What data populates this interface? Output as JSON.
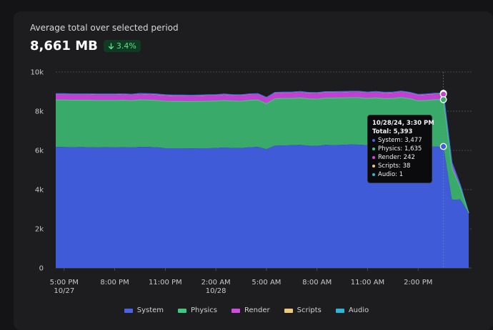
{
  "header": {
    "subtitle": "Average total over selected period",
    "total": "8,661 MB",
    "delta": "3.4%"
  },
  "tooltip": {
    "title": "10/28/24, 3:30 PM",
    "total": "Total: 5,393",
    "rows": [
      {
        "label": "System: 3,477",
        "color": "#4a63e6"
      },
      {
        "label": "Physics: 1,635",
        "color": "#3ccb7a"
      },
      {
        "label": "Render: 242",
        "color": "#d24be0"
      },
      {
        "label": "Scripts: 38",
        "color": "#efc87a"
      },
      {
        "label": "Audio: 1",
        "color": "#2ab8d8"
      }
    ]
  },
  "chart_data": {
    "type": "area",
    "stacked": true,
    "ylim": [
      0,
      10000
    ],
    "grid": true,
    "legend_position": "bottom",
    "y_ticks": [
      {
        "value": 0,
        "label": "0"
      },
      {
        "value": 2000,
        "label": "2k"
      },
      {
        "value": 4000,
        "label": "4k"
      },
      {
        "value": 6000,
        "label": "6k"
      },
      {
        "value": 8000,
        "label": "8k"
      },
      {
        "value": 10000,
        "label": "10k"
      }
    ],
    "x_ticks": [
      {
        "hour": 0,
        "label": "5:00 PM",
        "sublabel": "10/27"
      },
      {
        "hour": 3,
        "label": "8:00 PM",
        "sublabel": ""
      },
      {
        "hour": 6,
        "label": "11:00 PM",
        "sublabel": ""
      },
      {
        "hour": 9,
        "label": "2:00 AM",
        "sublabel": "10/28"
      },
      {
        "hour": 12,
        "label": "5:00 AM",
        "sublabel": ""
      },
      {
        "hour": 15,
        "label": "8:00 AM",
        "sublabel": ""
      },
      {
        "hour": 18,
        "label": "11:00 AM",
        "sublabel": ""
      },
      {
        "hour": 21,
        "label": "2:00 PM",
        "sublabel": ""
      }
    ],
    "x_hours_since_5pm_10_27": [
      -0.5,
      0,
      0.5,
      1,
      1.5,
      2,
      2.5,
      3,
      3.5,
      4,
      4.5,
      5,
      5.5,
      6,
      6.5,
      7,
      7.5,
      8,
      8.5,
      9,
      9.5,
      10,
      10.5,
      11,
      11.5,
      12,
      12.5,
      13,
      13.5,
      14,
      14.5,
      15,
      15.5,
      16,
      16.5,
      17,
      17.5,
      18,
      18.5,
      19,
      19.5,
      20,
      20.5,
      21,
      21.5,
      22,
      22.5,
      23,
      23.5,
      24
    ],
    "series": [
      {
        "name": "System",
        "color": "#3f5bd8",
        "values": [
          6180,
          6170,
          6160,
          6170,
          6160,
          6150,
          6160,
          6150,
          6160,
          6150,
          6180,
          6170,
          6160,
          6110,
          6110,
          6110,
          6100,
          6110,
          6110,
          6120,
          6150,
          6120,
          6120,
          6160,
          6180,
          6060,
          6240,
          6250,
          6260,
          6280,
          6240,
          6230,
          6280,
          6270,
          6280,
          6300,
          6290,
          6260,
          6280,
          6250,
          6260,
          6300,
          6250,
          6200,
          6160,
          6200,
          6200,
          3477,
          3500,
          2800
        ]
      },
      {
        "name": "Physics",
        "color": "#3aaa6a",
        "values": [
          2390,
          2400,
          2400,
          2390,
          2400,
          2400,
          2390,
          2400,
          2400,
          2390,
          2400,
          2400,
          2390,
          2400,
          2390,
          2390,
          2390,
          2390,
          2400,
          2400,
          2400,
          2400,
          2390,
          2400,
          2390,
          2320,
          2390,
          2400,
          2390,
          2400,
          2390,
          2390,
          2390,
          2400,
          2400,
          2390,
          2400,
          2390,
          2400,
          2390,
          2390,
          2400,
          2390,
          2330,
          2390,
          2390,
          2390,
          1635,
          600,
          0
        ]
      },
      {
        "name": "Render",
        "color": "#c23fd4",
        "values": [
          280,
          280,
          280,
          280,
          280,
          280,
          280,
          280,
          280,
          280,
          280,
          280,
          280,
          280,
          280,
          280,
          280,
          280,
          280,
          280,
          280,
          280,
          280,
          280,
          280,
          280,
          280,
          280,
          280,
          280,
          280,
          280,
          280,
          280,
          280,
          280,
          280,
          280,
          280,
          280,
          280,
          280,
          280,
          280,
          280,
          280,
          280,
          242,
          120,
          0
        ]
      },
      {
        "name": "Scripts",
        "color": "#e0b870",
        "values": [
          40,
          40,
          40,
          40,
          40,
          40,
          40,
          40,
          40,
          40,
          40,
          40,
          40,
          40,
          40,
          40,
          40,
          40,
          40,
          40,
          40,
          40,
          40,
          40,
          40,
          40,
          40,
          40,
          40,
          40,
          40,
          40,
          40,
          40,
          40,
          40,
          40,
          40,
          40,
          40,
          40,
          40,
          40,
          40,
          40,
          40,
          40,
          38,
          20,
          0
        ]
      },
      {
        "name": "Audio",
        "color": "#22aad0",
        "values": [
          1,
          1,
          1,
          1,
          1,
          1,
          1,
          1,
          1,
          1,
          1,
          1,
          1,
          1,
          1,
          1,
          1,
          1,
          1,
          1,
          1,
          1,
          1,
          1,
          1,
          1,
          1,
          1,
          1,
          1,
          1,
          1,
          1,
          1,
          1,
          1,
          1,
          1,
          1,
          1,
          1,
          1,
          1,
          1,
          1,
          1,
          1,
          1,
          1,
          0
        ]
      }
    ],
    "hover_hour": 22.5
  },
  "legend": {
    "items": [
      {
        "name": "System",
        "color": "#4a63e6"
      },
      {
        "name": "Physics",
        "color": "#3ccb7a"
      },
      {
        "name": "Render",
        "color": "#d24be0"
      },
      {
        "name": "Scripts",
        "color": "#efc87a"
      },
      {
        "name": "Audio",
        "color": "#2ab8d8"
      }
    ]
  }
}
